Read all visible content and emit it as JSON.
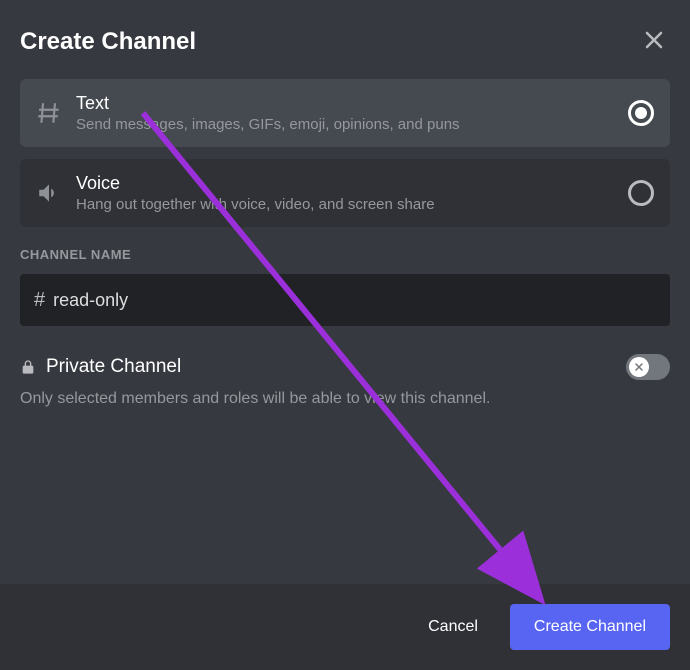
{
  "modal": {
    "title": "Create Channel"
  },
  "channelTypes": {
    "text": {
      "title": "Text",
      "desc": "Send messages, images, GIFs, emoji, opinions, and puns"
    },
    "voice": {
      "title": "Voice",
      "desc": "Hang out together with voice, video, and screen share"
    }
  },
  "channelName": {
    "label": "CHANNEL NAME",
    "prefix": "#",
    "value": "read-only"
  },
  "private": {
    "label": "Private Channel",
    "desc": "Only selected members and roles will be able to view this channel."
  },
  "footer": {
    "cancel": "Cancel",
    "create": "Create Channel"
  }
}
